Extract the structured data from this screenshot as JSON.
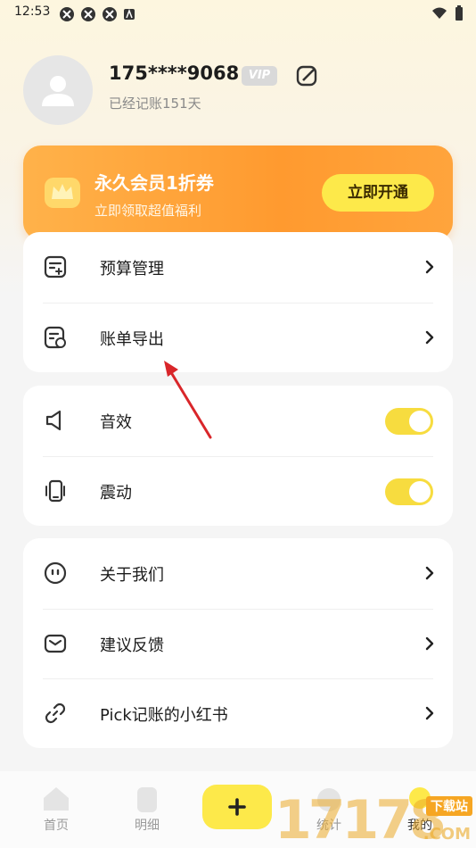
{
  "status_bar": {
    "time": "12:53"
  },
  "profile": {
    "phone": "175****9068",
    "vip_label": "VIP",
    "days_text": "已经记账151天"
  },
  "banner": {
    "title": "永久会员1折券",
    "subtitle": "立即领取超值福利",
    "button": "立即开通"
  },
  "menu_group_1": [
    {
      "label": "预算管理",
      "icon": "budget-icon"
    },
    {
      "label": "账单导出",
      "icon": "export-icon"
    }
  ],
  "menu_group_2": [
    {
      "label": "音效",
      "icon": "speaker-icon",
      "toggle": true
    },
    {
      "label": "震动",
      "icon": "vibrate-icon",
      "toggle": true
    }
  ],
  "menu_group_3": [
    {
      "label": "关于我们",
      "icon": "smile-icon"
    },
    {
      "label": "建议反馈",
      "icon": "mail-icon"
    },
    {
      "label": "Pick记账的小红书",
      "icon": "link-icon"
    }
  ],
  "tabbar": {
    "tabs": [
      {
        "label": "首页",
        "icon": "home-icon"
      },
      {
        "label": "明细",
        "icon": "list-icon"
      },
      {
        "label": "统计",
        "icon": "chart-icon"
      },
      {
        "label": "我的",
        "icon": "profile-icon"
      }
    ],
    "add_symbol": "+"
  },
  "watermark": {
    "digits": "17178",
    "top_text": "下载站",
    "suffix": ".COM"
  },
  "colors": {
    "accent_yellow": "#fde94a",
    "banner_orange": "#ff9a2f",
    "toggle_on": "#f7dc3f"
  }
}
